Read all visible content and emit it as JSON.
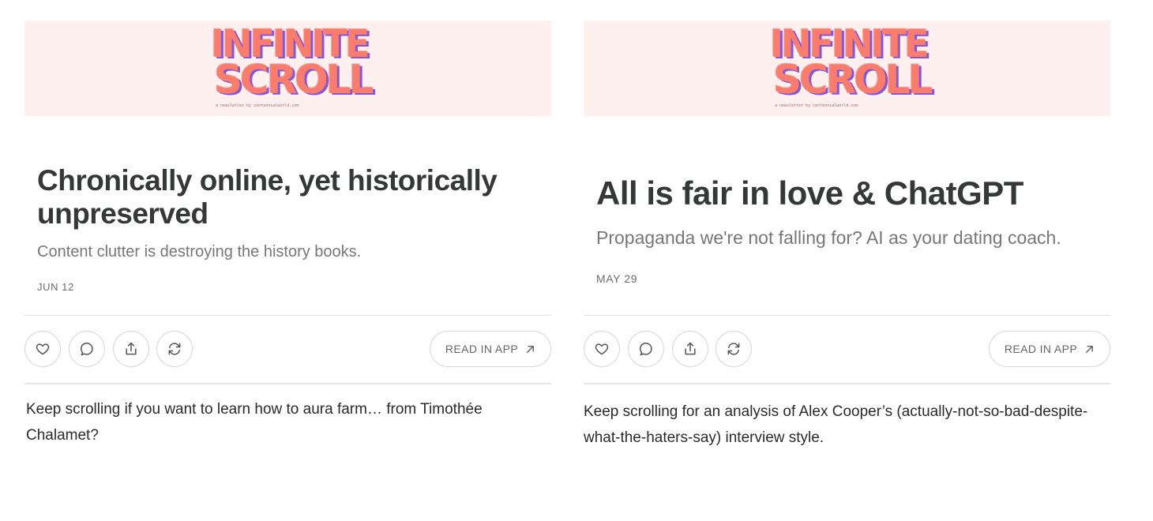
{
  "colors": {
    "banner_bg": "#fdf0ee",
    "logo_fill": "#f97c6d",
    "logo_shadow": "#7e58e0",
    "title": "#363737",
    "subtitle": "#777777",
    "divider": "#e0e0e0"
  },
  "icons": [
    "heart-icon",
    "comment-icon",
    "share-icon",
    "restack-icon",
    "arrow-up-right-icon"
  ],
  "posts": [
    {
      "logo": {
        "line1": "INFINITE",
        "line2": "SCROLL",
        "tagline": "a newsletter by centennialworld.com"
      },
      "title": "Chronically online, yet historically unpreserved",
      "subtitle": "Content clutter is destroying the history books.",
      "date": "JUN 12",
      "read_in_app": "READ IN APP",
      "teaser": "Keep scrolling if you want to learn how to aura farm… from Timothée Chalamet?"
    },
    {
      "logo": {
        "line1": "INFINITE",
        "line2": "SCROLL",
        "tagline": "a newsletter by centennialworld.com"
      },
      "title": "All is fair in love & ChatGPT",
      "subtitle": "Propaganda we're not falling for? AI as your dating coach.",
      "date": "MAY 29",
      "read_in_app": "READ IN APP",
      "teaser": "Keep scrolling for an analysis of Alex Cooper’s (actually-not-so-bad-despite-what-the-haters-say) interview style."
    }
  ]
}
